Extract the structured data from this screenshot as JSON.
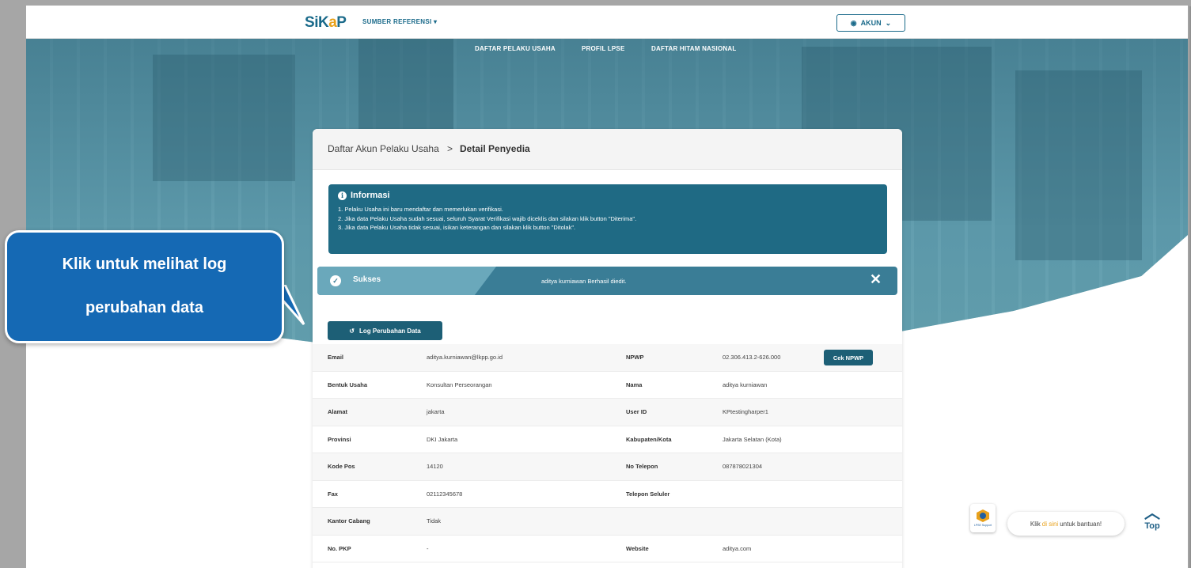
{
  "header": {
    "logo": {
      "s": "S",
      "i": "i",
      "k": "K",
      "a": "a",
      "p": "P"
    },
    "ref_menu": "SUMBER REFERENSI",
    "account_label": "AKUN"
  },
  "nav": {
    "items": [
      {
        "label": "DAFTAR PELAKU USAHA"
      },
      {
        "label": "PROFIL LPSE"
      },
      {
        "label": "DAFTAR HITAM NASIONAL"
      }
    ]
  },
  "breadcrumb": {
    "parent": "Daftar Akun Pelaku Usaha",
    "separator": ">",
    "current": "Detail Penyedia"
  },
  "info": {
    "title": "Informasi",
    "lines": [
      "1. Pelaku Usaha ini baru mendaftar dan memerlukan verifikasi.",
      "2. Jika data Pelaku Usaha sudah sesuai, seluruh Syarat Verifikasi wajib diceklis dan silakan klik button \"Diterima\".",
      "3. Jika data Pelaku Usaha tidak sesuai, isikan keterangan dan silakan klik button \"Ditolak\"."
    ]
  },
  "alert": {
    "label": "Sukses",
    "message": "aditya kurniawan Berhasil diedit.",
    "close": "✕"
  },
  "log_button": "Log Perubahan Data",
  "details": [
    {
      "k1": "Email",
      "v1": "aditya.kurniawan@lkpp.go.id",
      "k2": "NPWP",
      "v2": "02.306.413.2-626.000",
      "action": "Cek NPWP"
    },
    {
      "k1": "Bentuk Usaha",
      "v1": "Konsultan Perseorangan",
      "k2": "Nama",
      "v2": "aditya kurniawan"
    },
    {
      "k1": "Alamat",
      "v1": "jakarta",
      "k2": "User ID",
      "v2": "KPtestingharper1"
    },
    {
      "k1": "Provinsi",
      "v1": "DKI Jakarta",
      "k2": "Kabupaten/Kota",
      "v2": "Jakarta Selatan (Kota)"
    },
    {
      "k1": "Kode Pos",
      "v1": "14120",
      "k2": "No Telepon",
      "v2": "087878021304"
    },
    {
      "k1": "Fax",
      "v1": "02112345678",
      "k2": "Telepon Seluler",
      "v2": ""
    },
    {
      "k1": "Kantor Cabang",
      "v1": "Tidak",
      "k2": "",
      "v2": ""
    },
    {
      "k1": "No. PKP",
      "v1": "-",
      "k2": "Website",
      "v2": "aditya.com"
    }
  ],
  "callout": {
    "line1": "Klik untuk melihat log",
    "line2": "perubahan data"
  },
  "help": {
    "icon_caption": "LPSE Support",
    "pre": "Klik",
    "link": "di sini",
    "post": "untuk bantuan!"
  },
  "top_button": "Top",
  "colors": {
    "primary": "#1d5f76",
    "accent": "#e8a11b",
    "callout": "#1569b4"
  }
}
